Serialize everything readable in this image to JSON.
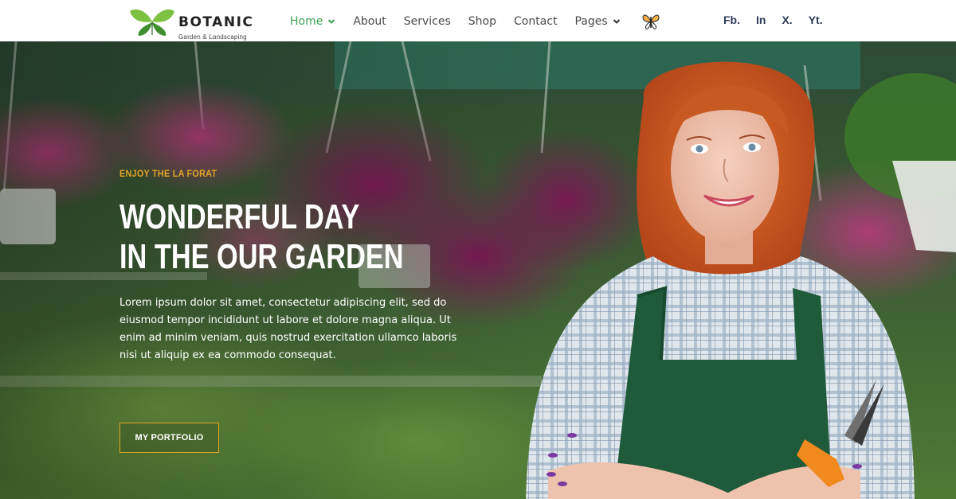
{
  "brand": {
    "name": "BOTANIC",
    "tagline": "Garden & Landscaping"
  },
  "nav": {
    "items": [
      {
        "label": "Home",
        "active": true,
        "dropdown": true
      },
      {
        "label": "About",
        "active": false,
        "dropdown": false
      },
      {
        "label": "Services",
        "active": false,
        "dropdown": false
      },
      {
        "label": "Shop",
        "active": false,
        "dropdown": false
      },
      {
        "label": "Contact",
        "active": false,
        "dropdown": false
      },
      {
        "label": "Pages",
        "active": false,
        "dropdown": true
      }
    ],
    "icon": "butterfly-icon"
  },
  "social": {
    "items": [
      "Fb.",
      "In",
      "X.",
      "Yt."
    ]
  },
  "hero": {
    "eyebrow": "ENJOY THE LA FORAT",
    "headline_line1": "WONDERFUL DAY",
    "headline_line2": "IN THE OUR GARDEN",
    "body": "Lorem ipsum dolor sit amet, consectetur adipiscing elit, sed do eiusmod tempor incididunt ut labore et dolore magna aliqua. Ut enim ad minim veniam, quis nostrud exercitation ullamco laboris nisi ut aliquip ex ea commodo consequat.",
    "cta_label": "MY PORTFOLIO"
  },
  "colors": {
    "accent_green": "#3aa351",
    "accent_gold": "#e0a526",
    "social_navy": "#2d3c5a"
  }
}
